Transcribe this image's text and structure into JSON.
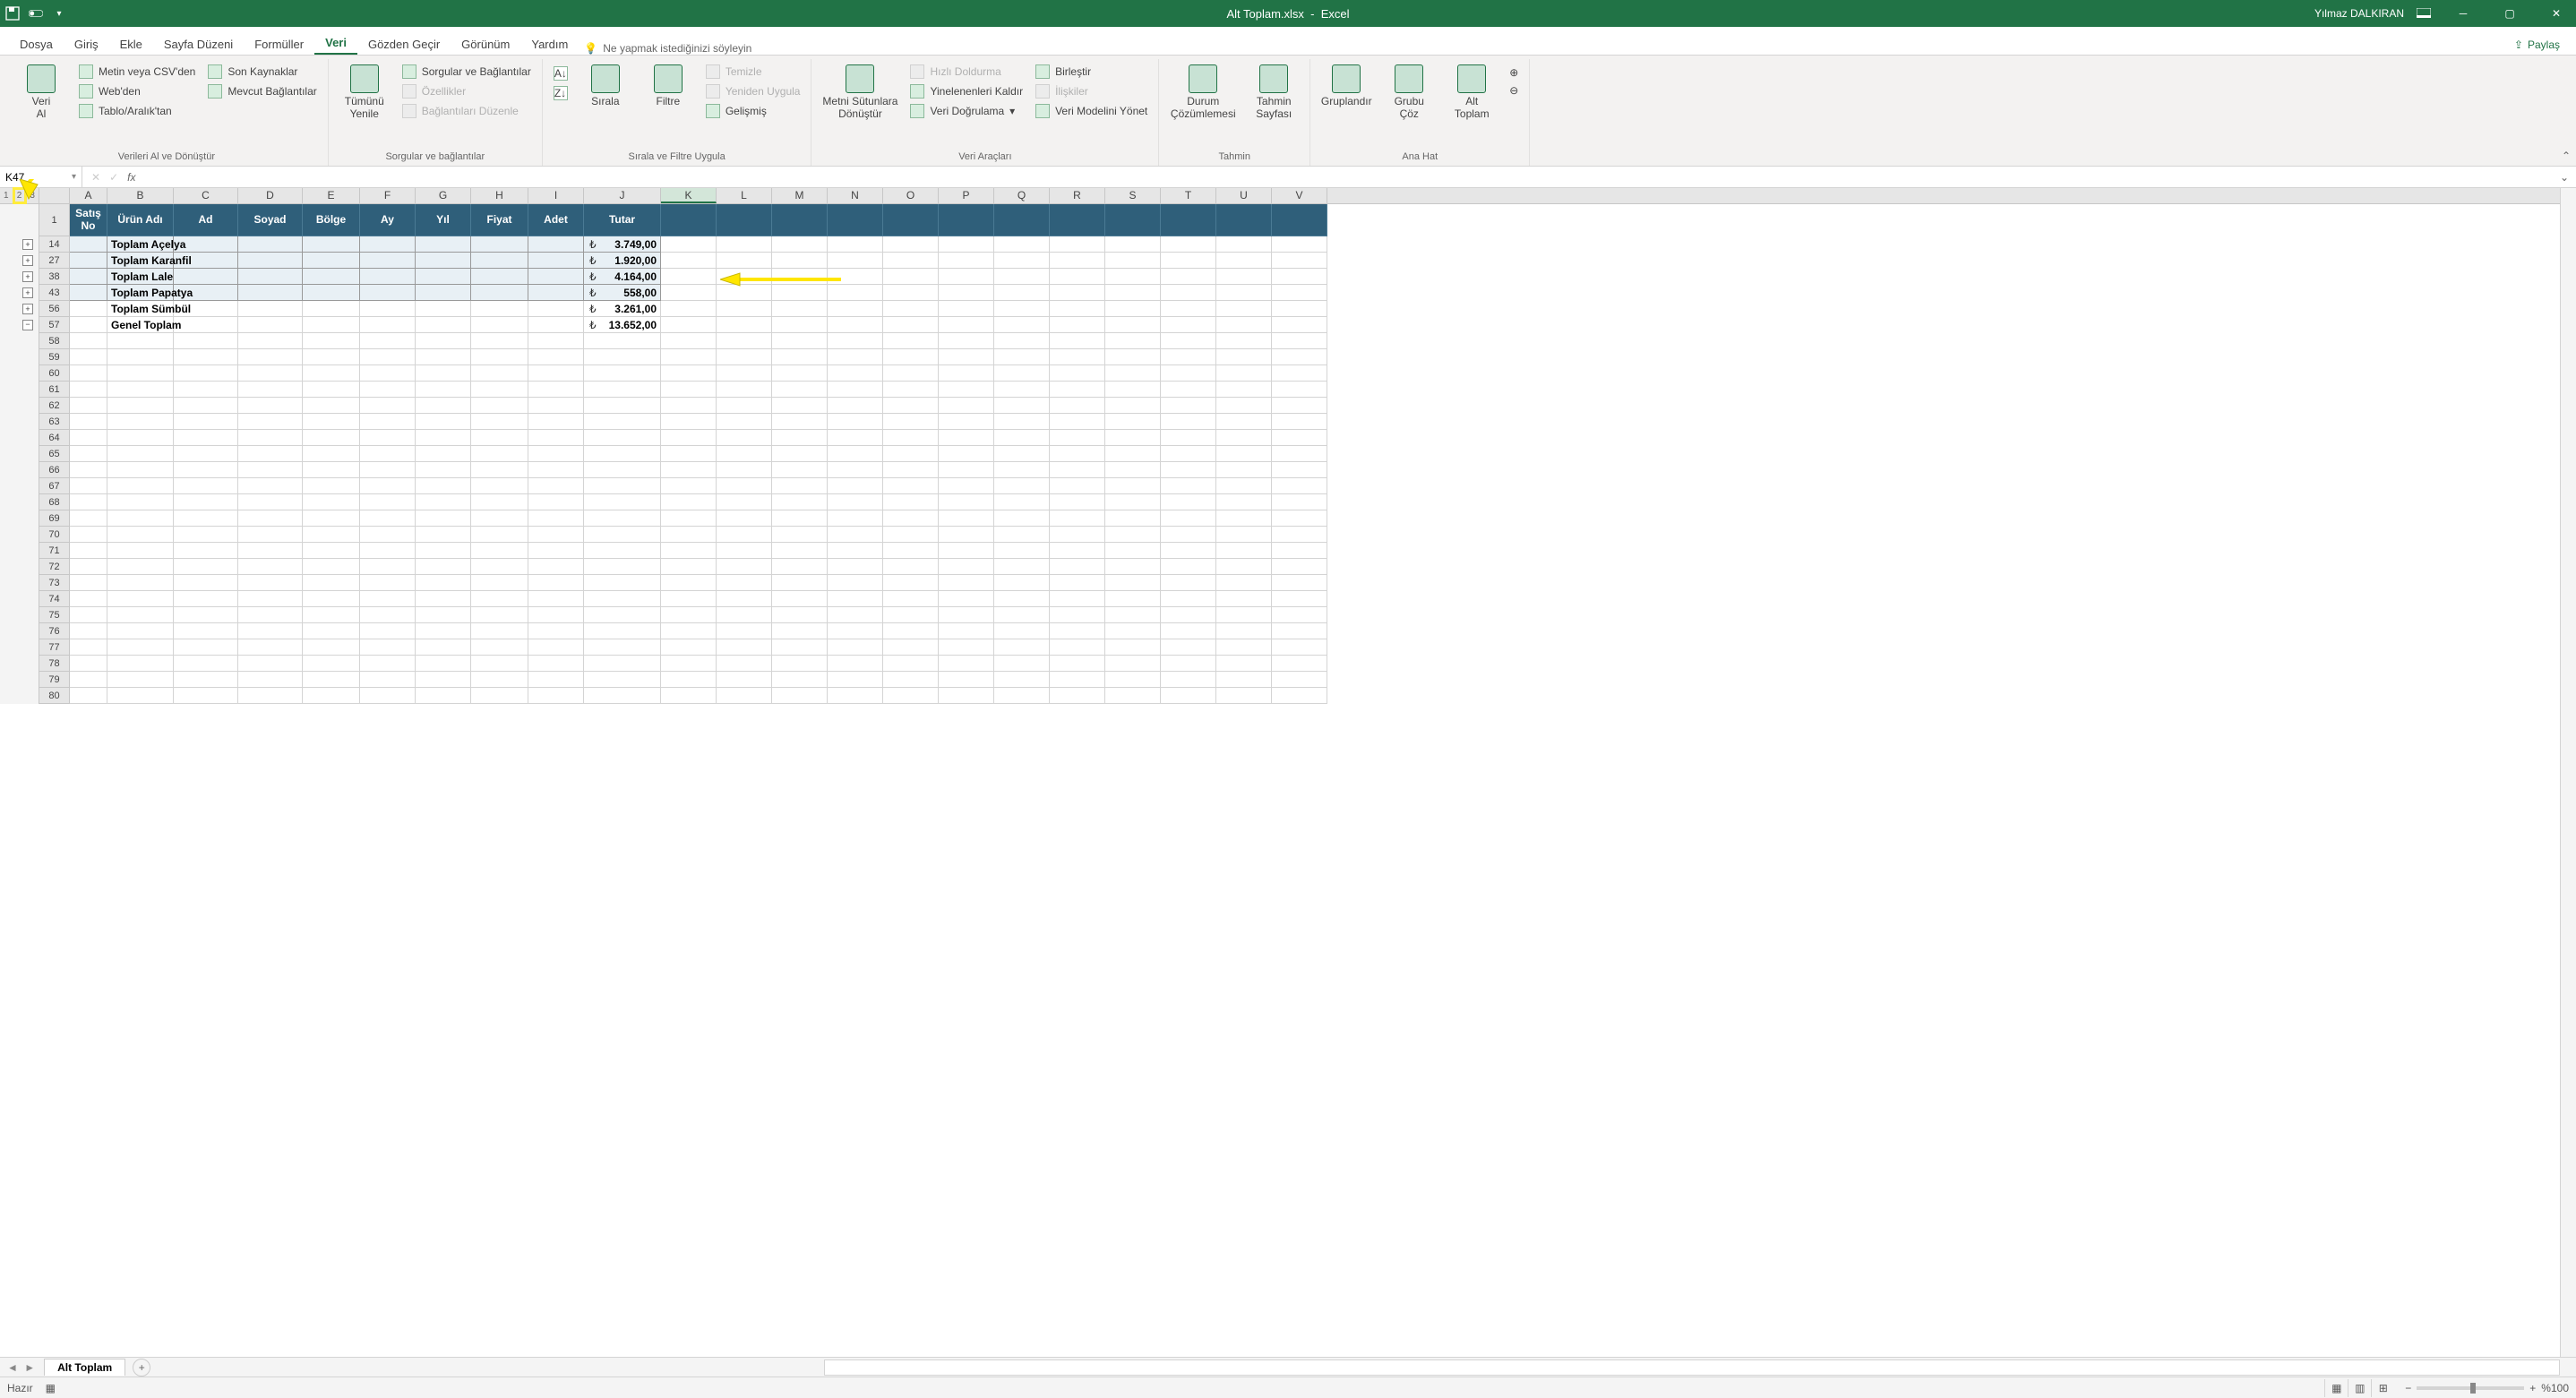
{
  "title": {
    "file": "Alt Toplam.xlsx",
    "app": "Excel"
  },
  "user": "Yılmaz DALKIRAN",
  "tabs": [
    "Dosya",
    "Giriş",
    "Ekle",
    "Sayfa Düzeni",
    "Formüller",
    "Veri",
    "Gözden Geçir",
    "Görünüm",
    "Yardım"
  ],
  "active_tab": "Veri",
  "tellme": "Ne yapmak istediğinizi söyleyin",
  "share": "Paylaş",
  "ribbon": {
    "g1": {
      "veri_al": "Veri\nAl",
      "csv": "Metin veya CSV'den",
      "web": "Web'den",
      "tablo": "Tablo/Aralık'tan",
      "son": "Son Kaynaklar",
      "mevcut": "Mevcut Bağlantılar",
      "label": "Verileri Al ve Dönüştür"
    },
    "g2": {
      "yenile": "Tümünü\nYenile",
      "sorgu": "Sorgular ve Bağlantılar",
      "ozellik": "Özellikler",
      "baglanti": "Bağlantıları Düzenle",
      "label": "Sorgular ve bağlantılar"
    },
    "g3": {
      "sirala": "Sırala",
      "filtre": "Filtre",
      "temizle": "Temizle",
      "yeniden": "Yeniden Uygula",
      "gelismis": "Gelişmiş",
      "label": "Sırala ve Filtre Uygula"
    },
    "g4": {
      "metni": "Metni Sütunlara\nDönüştür",
      "hizli": "Hızlı Doldurma",
      "yinelenenleri": "Yinelenenleri Kaldır",
      "dogrulama": "Veri Doğrulama",
      "birlestir": "Birleştir",
      "iliskiler": "İlişkiler",
      "modeli": "Veri Modelini Yönet",
      "label": "Veri Araçları"
    },
    "g5": {
      "durum": "Durum\nÇözümlemesi",
      "tahmin": "Tahmin\nSayfası",
      "label": "Tahmin"
    },
    "g6": {
      "gruplandir": "Gruplandır",
      "coz": "Grubu\nÇöz",
      "alt_toplam": "Alt\nToplam",
      "label": "Ana Hat"
    }
  },
  "namebox": "K47",
  "columns": [
    "A",
    "B",
    "C",
    "D",
    "E",
    "F",
    "G",
    "H",
    "I",
    "J",
    "K",
    "L",
    "M",
    "N",
    "O",
    "P",
    "Q",
    "R",
    "S",
    "T",
    "U",
    "V"
  ],
  "header_row": [
    "Satış\nNo",
    "Ürün Adı",
    "Ad",
    "Soyad",
    "Bölge",
    "Ay",
    "Yıl",
    "Fiyat",
    "Adet",
    "Tutar"
  ],
  "outline_levels": [
    "1",
    "2",
    "3"
  ],
  "data_rows": [
    {
      "rn": "14",
      "b": "Toplam Açelya",
      "j": "3.749,00",
      "plus": true
    },
    {
      "rn": "27",
      "b": "Toplam Karanfil",
      "j": "1.920,00",
      "plus": true
    },
    {
      "rn": "38",
      "b": "Toplam Lale",
      "j": "4.164,00",
      "plus": true
    },
    {
      "rn": "43",
      "b": "Toplam Papatya",
      "j": "558,00",
      "plus": true
    },
    {
      "rn": "56",
      "b": "Toplam Sümbül",
      "j": "3.261,00",
      "plus": true,
      "nofill": true
    },
    {
      "rn": "57",
      "b": "Genel Toplam",
      "j": "13.652,00",
      "minus": true,
      "nofill": true
    }
  ],
  "blank_rows": [
    "58",
    "59",
    "60",
    "61",
    "62",
    "63",
    "64",
    "65",
    "66",
    "67",
    "68",
    "69",
    "70",
    "71",
    "72",
    "73",
    "74",
    "75",
    "76",
    "77",
    "78",
    "79",
    "80"
  ],
  "sheet_tab": "Alt Toplam",
  "status": "Hazır",
  "zoom": "%100",
  "chart_data": {
    "type": "table",
    "title": "Alt Toplam",
    "columns": [
      "Satış No",
      "Ürün Adı",
      "Ad",
      "Soyad",
      "Bölge",
      "Ay",
      "Yıl",
      "Fiyat",
      "Adet",
      "Tutar"
    ],
    "rows": [
      {
        "Ürün Adı": "Toplam Açelya",
        "Tutar": 3749.0
      },
      {
        "Ürün Adı": "Toplam Karanfil",
        "Tutar": 1920.0
      },
      {
        "Ürün Adı": "Toplam Lale",
        "Tutar": 4164.0
      },
      {
        "Ürün Adı": "Toplam Papatya",
        "Tutar": 558.0
      },
      {
        "Ürün Adı": "Toplam Sümbül",
        "Tutar": 3261.0
      },
      {
        "Ürün Adı": "Genel Toplam",
        "Tutar": 13652.0
      }
    ],
    "currency": "TRY"
  }
}
